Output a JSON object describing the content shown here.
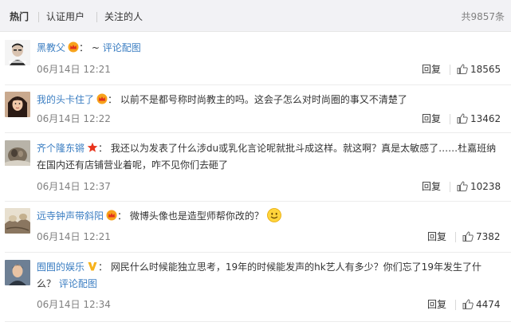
{
  "tabs": [
    {
      "label": "热门",
      "active": true
    },
    {
      "label": "认证用户",
      "active": false
    },
    {
      "label": "关注的人",
      "active": false
    }
  ],
  "total_count": "共9857条",
  "colors": {
    "accent": "#eb7350",
    "link": "#3b7ec2",
    "muted": "#808080",
    "tab_bar": "#f2f2f5"
  },
  "comments": [
    {
      "name": "黑教父",
      "badge_icon": "vip-crown-icon",
      "separator": "：",
      "text": "~",
      "link": "评论配图",
      "time": "06月14日 12:21",
      "reply_label": "回复",
      "like_icon": "thumbs-up-icon",
      "likes": "18565"
    },
    {
      "name": "我的头卡住了",
      "badge_icon": "vip-crown-icon",
      "separator": "：",
      "text": "以前不是都号称时尚教主的吗。这会子怎么对时尚圈的事又不清楚了",
      "time": "06月14日 12:22",
      "reply_label": "回复",
      "like_icon": "thumbs-up-icon",
      "likes": "13462"
    },
    {
      "name": "齐个隆东锵",
      "badge_icon": "red-star-icon",
      "separator": "：",
      "text_line1": "我还以为发表了什么涉du或乳化言论呢就批斗成这样。就这啊？真是太敏感了……杜嘉班纳",
      "text_line2": "在国内还有店铺营业着呢，咋不见你们去砸了",
      "time": "06月14日 12:37",
      "reply_label": "回复",
      "like_icon": "thumbs-up-icon",
      "likes": "10238"
    },
    {
      "name": "远寺钟声带斜阳",
      "badge_icon": "vip-crown-icon",
      "separator": "：",
      "text": "微博头像也是造型师帮你改的？",
      "emoji_icon": "smiley-face-icon",
      "time": "06月14日 12:21",
      "reply_label": "回复",
      "like_icon": "thumbs-up-icon",
      "likes": "7382"
    },
    {
      "name": "囿囿的娱乐",
      "badge_icon": "verified-v-icon",
      "separator": "：",
      "text_line1": "网民什么时候能独立思考，19年的时候能发声的hk艺人有多少？你们忘了19年发生了什",
      "text_line2": "么？",
      "link": "评论配图",
      "time": "06月14日 12:34",
      "reply_label": "回复",
      "like_icon": "thumbs-up-icon",
      "likes": "4474"
    }
  ]
}
